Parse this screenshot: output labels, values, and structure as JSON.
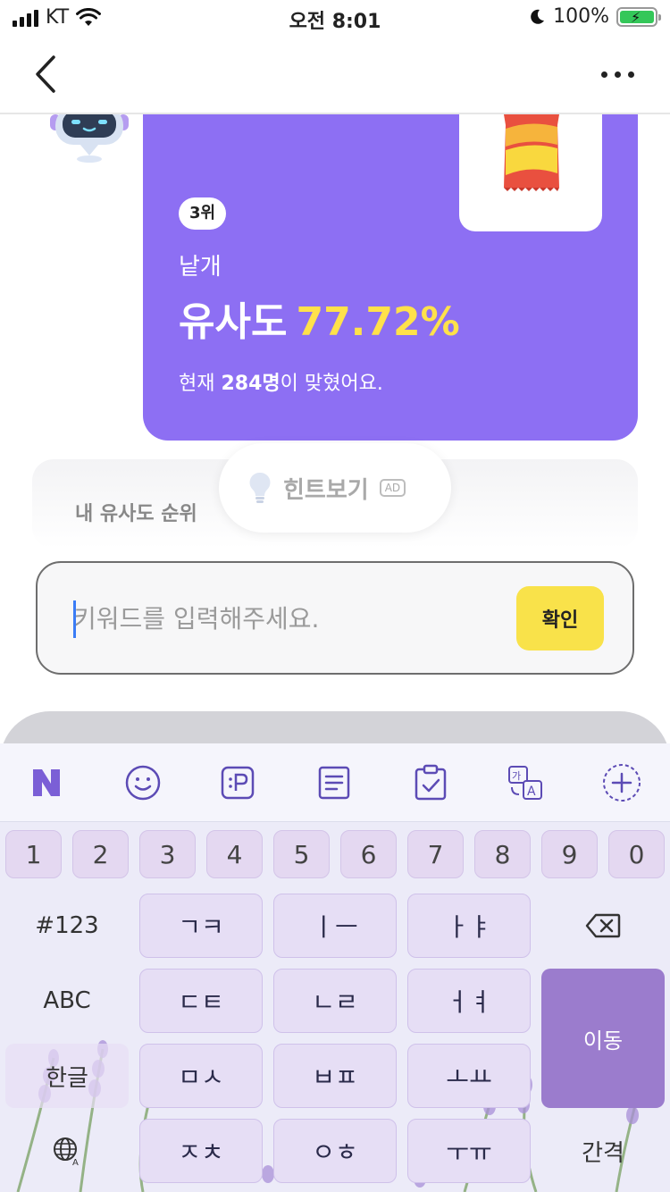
{
  "status_bar": {
    "carrier": "KT",
    "time": "오전 8:01",
    "battery": "100%"
  },
  "card": {
    "rank_badge": "3위",
    "keyword": "낱개",
    "similarity_label": "유사도",
    "similarity_value": "77.72%",
    "correct_prefix": "현재 ",
    "correct_count": "284명",
    "correct_suffix": "이 맞혔어요."
  },
  "rank_panel": {
    "label": "내 유사도 순위"
  },
  "hint": {
    "label": "힌트보기",
    "ad_badge": "AD"
  },
  "input": {
    "placeholder": "키워드를 입력해주세요.",
    "value": "",
    "confirm_label": "확인"
  },
  "keyboard": {
    "toolbar_icons": [
      "naver-n-icon",
      "emoji-icon",
      "pay-icon",
      "memo-icon",
      "clipboard-icon",
      "translate-icon",
      "add-icon"
    ],
    "number_row": [
      "1",
      "2",
      "3",
      "4",
      "5",
      "6",
      "7",
      "8",
      "9",
      "0"
    ],
    "row1": {
      "left": "#123",
      "keys": [
        "ㄱㅋ",
        "ㅣㅡ",
        "ㅏㅑ"
      ]
    },
    "row2": {
      "left": "ABC",
      "keys": [
        "ㄷㅌ",
        "ㄴㄹ",
        "ㅓㅕ"
      ],
      "action": "이동"
    },
    "row3": {
      "left": "한글",
      "keys": [
        "ㅁㅅ",
        "ㅂㅍ",
        "ㅗㅛ"
      ]
    },
    "row4": {
      "keys": [
        "ㅈㅊ",
        "ㅇㅎ",
        "ㅜㅠ"
      ],
      "space": "간격"
    }
  },
  "colors": {
    "card_purple": "#8d6ff3",
    "similarity_yellow": "#ffe14a",
    "confirm_yellow": "#f9e24a",
    "keyboard_action": "#9b7ccd"
  }
}
